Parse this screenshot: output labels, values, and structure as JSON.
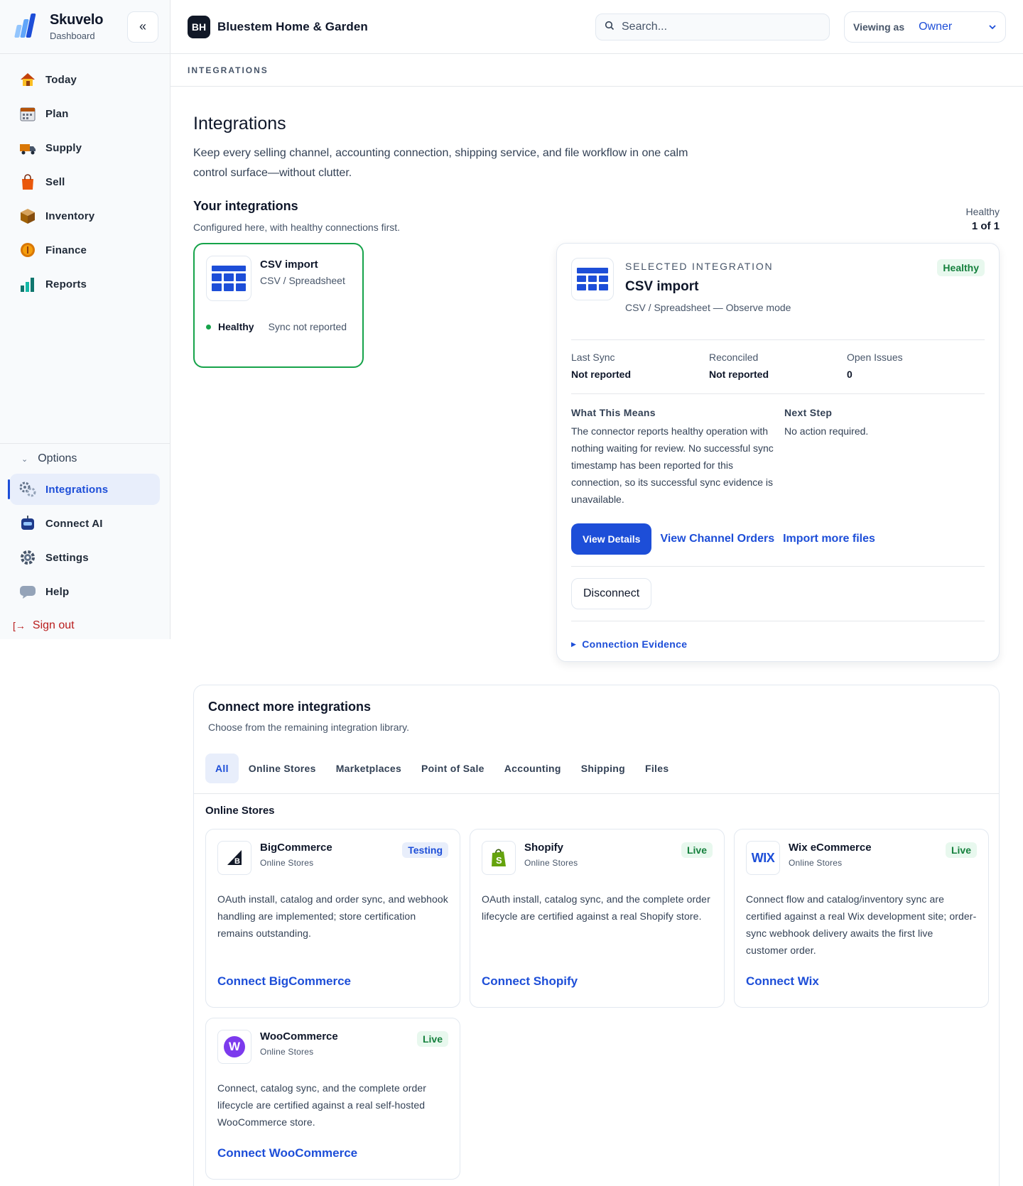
{
  "app": {
    "name": "Skuvelo",
    "subtitle": "Dashboard",
    "collapse_icon": "«"
  },
  "sidebar": {
    "items": [
      {
        "label": "Today",
        "icon": "house-icon"
      },
      {
        "label": "Plan",
        "icon": "calendar-icon"
      },
      {
        "label": "Supply",
        "icon": "truck-icon"
      },
      {
        "label": "Sell",
        "icon": "shopping-bag-icon"
      },
      {
        "label": "Inventory",
        "icon": "box-icon"
      },
      {
        "label": "Finance",
        "icon": "coin-icon"
      },
      {
        "label": "Reports",
        "icon": "chart-icon"
      }
    ],
    "options_label": "Options",
    "options_items": [
      {
        "label": "Integrations",
        "icon": "gears-icon",
        "active": true
      },
      {
        "label": "Connect AI",
        "icon": "robot-icon"
      },
      {
        "label": "Settings",
        "icon": "gear-icon"
      },
      {
        "label": "Help",
        "icon": "speech-bubble-icon"
      }
    ],
    "signout_label": "Sign out"
  },
  "topbar": {
    "workspace_initials": "BH",
    "workspace_name": "Bluestem Home & Garden",
    "search_placeholder": "Search...",
    "viewing_label": "Viewing as",
    "viewing_value": "Owner"
  },
  "breadcrumb": "INTEGRATIONS",
  "page": {
    "title": "Integrations",
    "description": "Keep every selling channel, accounting connection, shipping service, and file workflow in one calm control surface—without clutter.",
    "your_title": "Your integrations",
    "your_sub": "Configured here, with healthy connections first.",
    "health_label": "Healthy",
    "health_count": "1 of 1"
  },
  "connected": {
    "name": "CSV import",
    "type": "CSV / Spreadsheet",
    "health": "Healthy",
    "sync": "Sync not reported"
  },
  "selected": {
    "eyebrow": "SELECTED INTEGRATION",
    "name": "CSV import",
    "type": "CSV / Spreadsheet — Observe mode",
    "badge": "Healthy",
    "metrics": [
      {
        "label": "Last Sync",
        "value": "Not reported"
      },
      {
        "label": "Reconciled",
        "value": "Not reported"
      },
      {
        "label": "Open Issues",
        "value": "0"
      }
    ],
    "means_title": "What This Means",
    "means_text": "The connector reports healthy operation with nothing waiting for review. No successful sync timestamp has been reported for this connection, so its successful sync evidence is unavailable.",
    "next_title": "Next Step",
    "next_text": "No action required.",
    "view_details": "View Details",
    "view_orders": "View Channel Orders",
    "import_more": "Import more files",
    "disconnect": "Disconnect",
    "evidence": "Connection Evidence"
  },
  "library": {
    "title": "Connect more integrations",
    "subtitle": "Choose from the remaining integration library.",
    "tabs": [
      "All",
      "Online Stores",
      "Marketplaces",
      "Point of Sale",
      "Accounting",
      "Shipping",
      "Files"
    ],
    "group": "Online Stores",
    "cards": [
      {
        "name": "BigCommerce",
        "category": "Online Stores",
        "badge": "Testing",
        "desc": "OAuth install, catalog and order sync, and webhook handling are implemented; store certification remains outstanding.",
        "link": "Connect BigCommerce"
      },
      {
        "name": "Shopify",
        "category": "Online Stores",
        "badge": "Live",
        "desc": "OAuth install, catalog sync, and the complete order lifecycle are certified against a real Shopify store.",
        "link": "Connect Shopify"
      },
      {
        "name": "Wix eCommerce",
        "category": "Online Stores",
        "badge": "Live",
        "desc": "Connect flow and catalog/inventory sync are certified against a real Wix development site; order-sync webhook delivery awaits the first live customer order.",
        "link": "Connect Wix",
        "logo_text": "WIX"
      },
      {
        "name": "WooCommerce",
        "category": "Online Stores",
        "badge": "Live",
        "desc": "Connect, catalog sync, and the complete order lifecycle are certified against a real self-hosted WooCommerce store.",
        "link": "Connect WooCommerce",
        "logo_text": "W"
      }
    ]
  },
  "colors": {
    "accent": "#1d4ed8",
    "healthy": "#16a34a",
    "danger": "#b91c1c"
  }
}
